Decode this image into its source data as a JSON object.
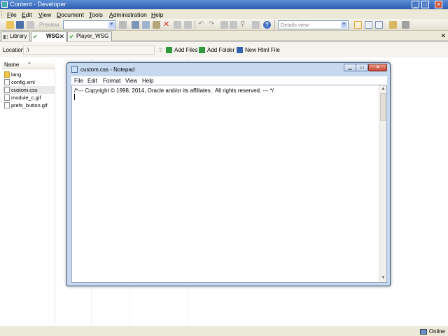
{
  "app": {
    "title": "Content - Developer",
    "window_controls": {
      "minimize": "_",
      "maximize": "□",
      "close": "✕"
    }
  },
  "menubar": {
    "items": [
      {
        "label": "File",
        "key": "F",
        "rest": "ile"
      },
      {
        "label": "Edit",
        "key": "E",
        "rest": "dit"
      },
      {
        "label": "View",
        "key": "V",
        "rest": "iew"
      },
      {
        "label": "Document",
        "key": "D",
        "rest": "ocument"
      },
      {
        "label": "Tools",
        "key": "T",
        "rest": "ools"
      },
      {
        "label": "Administration",
        "key": "A",
        "rest": "dministration"
      },
      {
        "label": "Help",
        "key": "H",
        "rest": "elp"
      }
    ]
  },
  "toolbar": {
    "preview_label": "Preview",
    "view_select_value": "Details view"
  },
  "tabs": [
    {
      "label": "Library",
      "icon": "library-icon"
    },
    {
      "label": "WSG",
      "icon": "check-icon",
      "active": true
    },
    {
      "label": "Player_WSG",
      "icon": "check-icon"
    }
  ],
  "location": {
    "label": "Location:",
    "value": ".\\",
    "add_files": "Add Files",
    "add_folder": "Add Folder",
    "new_html_file": "New Html File"
  },
  "tree": {
    "header": "Name",
    "items": [
      {
        "name": "lang",
        "icon": "folder-icon"
      },
      {
        "name": "config.xml",
        "icon": "file-icon"
      },
      {
        "name": "custom.css",
        "icon": "file-icon",
        "selected": true
      },
      {
        "name": "module_c.gif",
        "icon": "file-icon"
      },
      {
        "name": "prefs_button.gif",
        "icon": "file-icon"
      }
    ]
  },
  "status": {
    "connection": "Online"
  },
  "notepad": {
    "title": "custom.css - Notepad",
    "menu": [
      "File",
      "Edit",
      "Format",
      "View",
      "Help"
    ],
    "content": "/*--- Copyright © 1998, 2014, Oracle and/or its affiliates.  All rights reserved. --- */"
  },
  "colors": {
    "title_bar": "#3d6fbf",
    "notepad_frame": "#c6d9ef",
    "check_green": "#2e9d2e"
  }
}
